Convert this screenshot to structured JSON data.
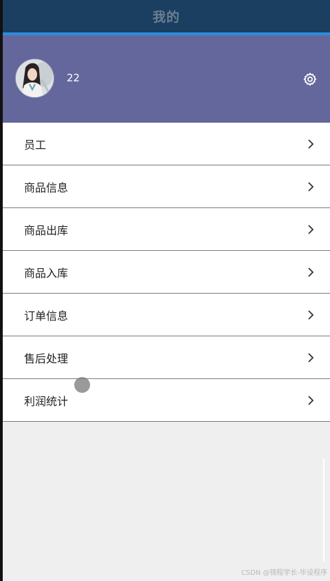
{
  "header": {
    "title": "我的"
  },
  "profile": {
    "username": "22",
    "settings_icon": "gear-icon",
    "background_color": "#64679b"
  },
  "menu": {
    "items": [
      {
        "label": "员工"
      },
      {
        "label": "商品信息"
      },
      {
        "label": "商品出库"
      },
      {
        "label": "商品入库"
      },
      {
        "label": "订单信息"
      },
      {
        "label": "售后处理"
      },
      {
        "label": "利润统计"
      }
    ],
    "chevron_icon": "chevron-right-icon"
  },
  "watermark": "CSDN @锦程学长-毕设程序",
  "colors": {
    "titlebar": "#1a3f60",
    "accent": "#2a8ce0",
    "background": "#efefef"
  }
}
